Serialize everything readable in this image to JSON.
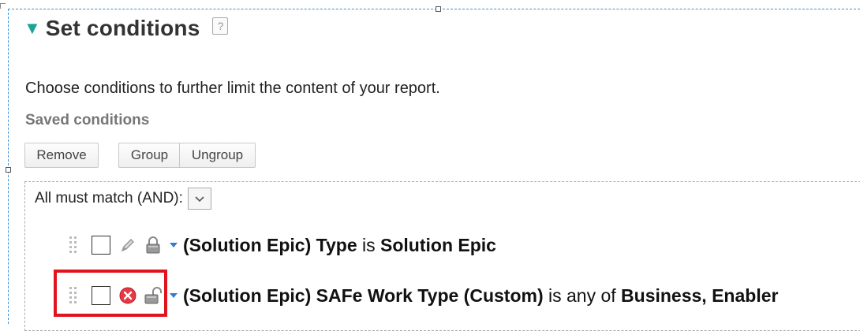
{
  "section": {
    "title": "Set conditions",
    "help_glyph": "?",
    "description": "Choose conditions to further limit the content of your report.",
    "saved_label": "Saved conditions"
  },
  "toolbar": {
    "remove_label": "Remove",
    "group_label": "Group",
    "ungroup_label": "Ungroup"
  },
  "conditions": {
    "match_label": "All must match (AND):",
    "rows": [
      {
        "field": "(Solution Epic) Type",
        "operator": "is",
        "value": "Solution Epic",
        "lock": "locked"
      },
      {
        "field": "(Solution Epic) SAFe Work Type (Custom)",
        "operator": "is any of",
        "value": "Business, Enabler",
        "lock": "unlocked"
      }
    ]
  },
  "colors": {
    "accent": "#1aa39a",
    "highlight": "#e0141e",
    "delete": "#e63946"
  }
}
